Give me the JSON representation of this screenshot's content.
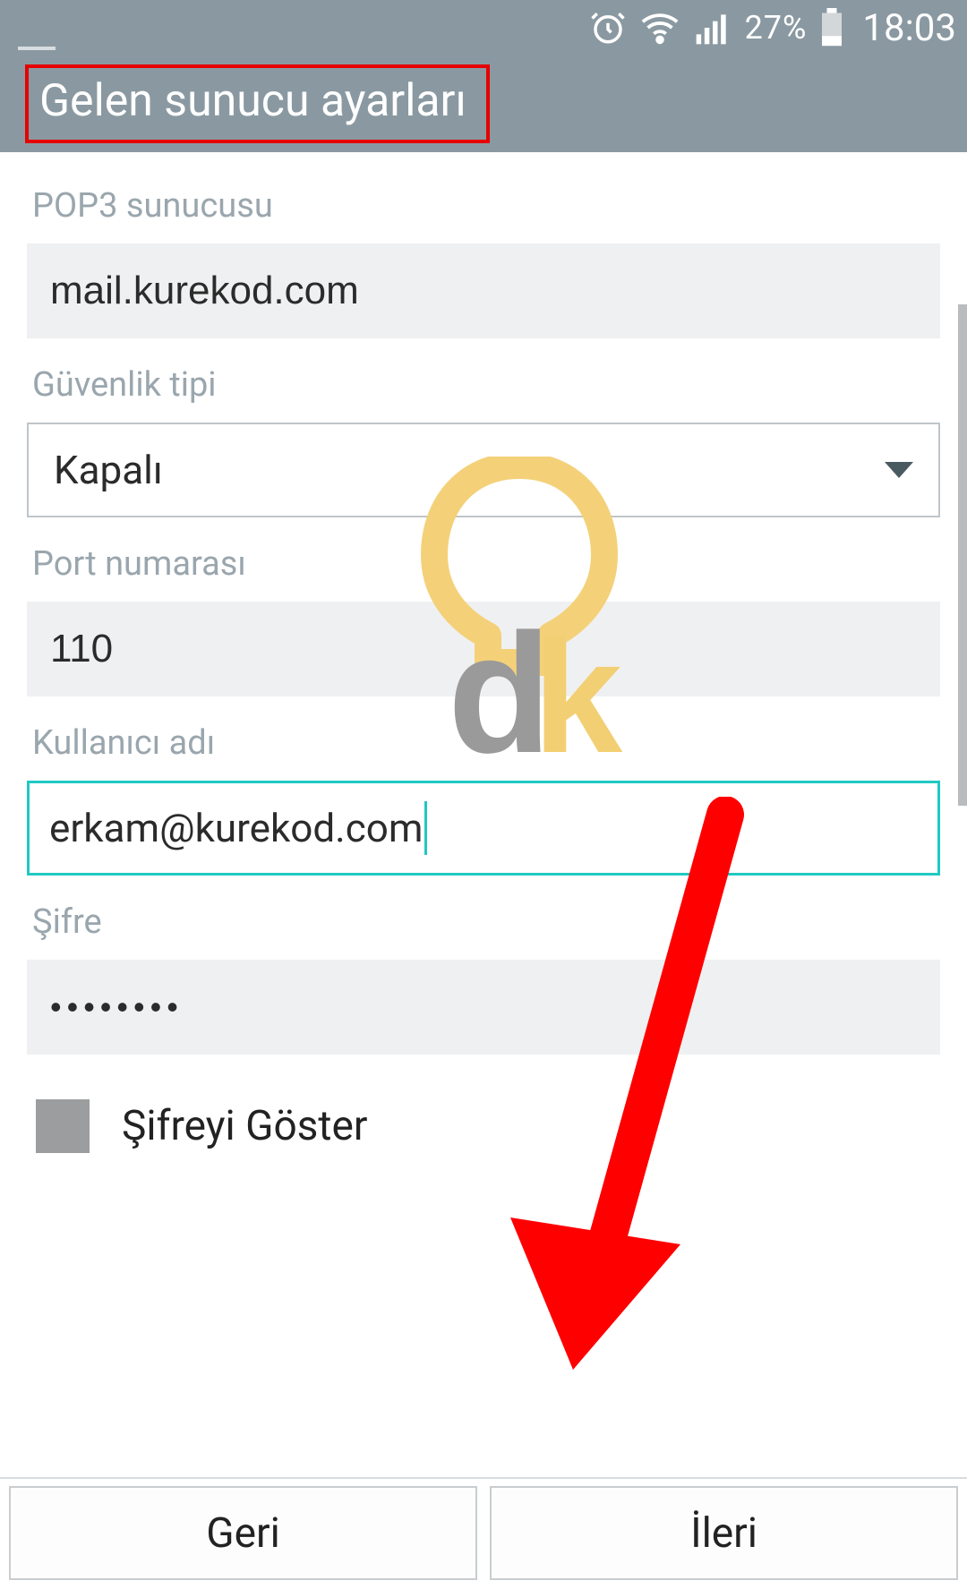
{
  "statusbar": {
    "battery_percent": "27%",
    "clock": "18:03"
  },
  "appbar": {
    "title": "Gelen sunucu ayarları"
  },
  "form": {
    "pop3_server": {
      "label": "POP3 sunucusu",
      "value": "mail.kurekod.com"
    },
    "security_type": {
      "label": "Güvenlik tipi",
      "value": "Kapalı"
    },
    "port": {
      "label": "Port numarası",
      "value": "110"
    },
    "username": {
      "label": "Kullanıcı adı",
      "value": "erkam@kurekod.com"
    },
    "password": {
      "label": "Şifre",
      "value": "••••••••"
    },
    "show_password": {
      "label": "Şifreyi Göster",
      "checked": false
    }
  },
  "buttons": {
    "back": "Geri",
    "next": "İleri"
  },
  "annotation": {
    "title_highlight_color": "#e60000",
    "arrow_color": "#ff0000"
  }
}
